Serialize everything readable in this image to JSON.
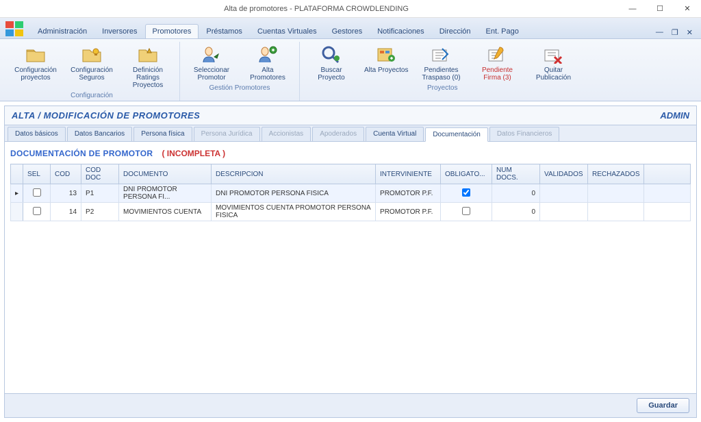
{
  "window": {
    "title": "Alta de promotores - PLATAFORMA CROWDLENDING"
  },
  "menubar": {
    "items": [
      "Administración",
      "Inversores",
      "Promotores",
      "Préstamos",
      "Cuentas Virtuales",
      "Gestores",
      "Notificaciones",
      "Dirección",
      "Ent. Pago"
    ],
    "active_index": 2
  },
  "ribbon": {
    "groups": [
      {
        "name": "Configuración",
        "buttons": [
          {
            "label": "Configuración proyectos"
          },
          {
            "label": "Configuración Seguros"
          },
          {
            "label": "Definición Ratings Proyectos"
          }
        ]
      },
      {
        "name": "Gestión Promotores",
        "buttons": [
          {
            "label": "Seleccionar Promotor"
          },
          {
            "label": "Alta Promotores"
          }
        ]
      },
      {
        "name": "Proyectos",
        "buttons": [
          {
            "label": "Buscar Proyecto"
          },
          {
            "label": "Alta Proyectos"
          },
          {
            "label": "Pendientes Traspaso (0)"
          },
          {
            "label": "Pendiente Firma (3)",
            "warn": true
          },
          {
            "label": "Quitar Publicación"
          }
        ]
      }
    ]
  },
  "panel": {
    "title": "ALTA / MODIFICACIÓN DE PROMOTORES",
    "user": "ADMIN"
  },
  "tabs": {
    "items": [
      {
        "label": "Datos básicos"
      },
      {
        "label": "Datos Bancarios"
      },
      {
        "label": "Persona física"
      },
      {
        "label": "Persona Jurídica",
        "disabled": true
      },
      {
        "label": "Accionistas",
        "disabled": true
      },
      {
        "label": "Apoderados",
        "disabled": true
      },
      {
        "label": "Cuenta Virtual"
      },
      {
        "label": "Documentación",
        "active": true
      },
      {
        "label": "Datos Financieros",
        "disabled": true
      }
    ]
  },
  "section": {
    "title": "DOCUMENTACIÓN DE PROMOTOR",
    "status": "( INCOMPLETA )"
  },
  "grid": {
    "columns": [
      "",
      "SEL",
      "COD",
      "COD DOC",
      "DOCUMENTO",
      "DESCRIPCION",
      "INTERVINIENTE",
      "OBLIGATO...",
      "NUM DOCS.",
      "VALIDADOS",
      "RECHAZADOS",
      ""
    ],
    "rows": [
      {
        "selected": true,
        "sel": false,
        "cod": "13",
        "cod_doc": "P1",
        "documento": "DNI PROMOTOR PERSONA FI...",
        "descripcion": "DNI PROMOTOR PERSONA FISICA",
        "interviniente": "PROMOTOR P.F.",
        "obligatorio": true,
        "num_docs": "0",
        "validados": "",
        "rechazados": ""
      },
      {
        "selected": false,
        "sel": false,
        "cod": "14",
        "cod_doc": "P2",
        "documento": "MOVIMIENTOS CUENTA",
        "descripcion": "MOVIMIENTOS CUENTA PROMOTOR PERSONA FISICA",
        "interviniente": "PROMOTOR P.F.",
        "obligatorio": false,
        "num_docs": "0",
        "validados": "",
        "rechazados": ""
      }
    ]
  },
  "footer": {
    "save": "Guardar"
  }
}
